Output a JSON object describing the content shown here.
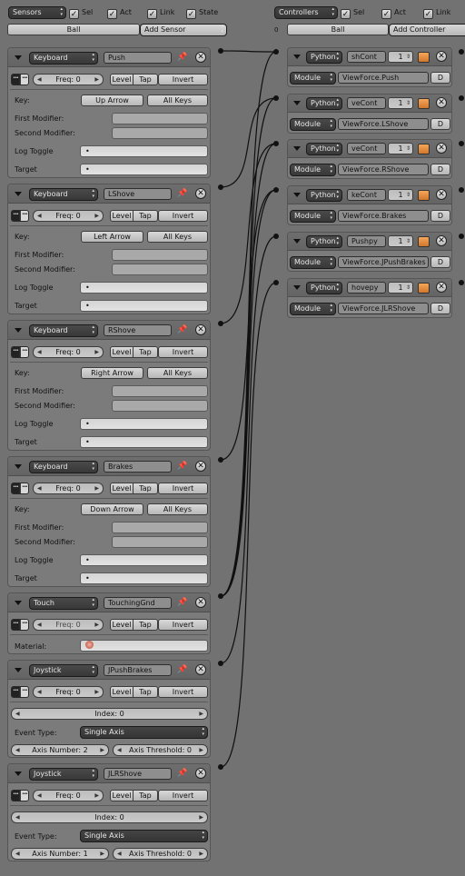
{
  "sensors_header": {
    "menu": "Sensors",
    "sel": "Sel",
    "act": "Act",
    "link": "Link",
    "state": "State",
    "object": "Ball",
    "add": "Add Sensor"
  },
  "controllers_header": {
    "menu": "Controllers",
    "sel": "Sel",
    "act": "Act",
    "link": "Link",
    "object": "Ball",
    "add": "Add Controller",
    "state_num": "0"
  },
  "freq_label": "Freq: 0",
  "level_label": "Level",
  "tap_label": "Tap",
  "invert_label": "Invert",
  "kb_labels": {
    "key": "Key:",
    "all_keys": "All Keys",
    "first": "First Modifier:",
    "second": "Second Modifier:",
    "log": "Log Toggle",
    "target": "Target",
    "dot": "•"
  },
  "keyboard_sensors": [
    {
      "type": "Keyboard",
      "name": "Push",
      "key": "Up Arrow"
    },
    {
      "type": "Keyboard",
      "name": "LShove",
      "key": "Left Arrow"
    },
    {
      "type": "Keyboard",
      "name": "RShove",
      "key": "Right Arrow"
    },
    {
      "type": "Keyboard",
      "name": "Brakes",
      "key": "Down Arrow"
    }
  ],
  "touch_sensor": {
    "type": "Touch",
    "name": "TouchingGnd",
    "material_label": "Material:"
  },
  "joystick_labels": {
    "index": "Index: 0",
    "event_type": "Event Type:",
    "event_value": "Single Axis",
    "axis_num_prefix": "Axis Number:",
    "axis_threshold": "Axis Threshold: 0"
  },
  "joystick_sensors": [
    {
      "type": "Joystick",
      "name": "JPushBrakes",
      "axis_number": "Axis Number: 2"
    },
    {
      "type": "Joystick",
      "name": "JLRShove",
      "axis_number": "Axis Number: 1"
    }
  ],
  "controllers": [
    {
      "type": "Python",
      "name": "shCont",
      "num": "1",
      "mode": "Module",
      "module": "ViewForce.Push",
      "d": "D"
    },
    {
      "type": "Python",
      "name": "veCont",
      "num": "1",
      "mode": "Module",
      "module": "ViewForce.LShove",
      "d": "D"
    },
    {
      "type": "Python",
      "name": "veCont",
      "num": "1",
      "mode": "Module",
      "module": "ViewForce.RShove",
      "d": "D"
    },
    {
      "type": "Python",
      "name": "keCont",
      "num": "1",
      "mode": "Module",
      "module": "ViewForce.Brakes",
      "d": "D"
    },
    {
      "type": "Python",
      "name": "Pushpy",
      "num": "1",
      "mode": "Module",
      "module": "ViewForce.JPushBrakes",
      "d": "D"
    },
    {
      "type": "Python",
      "name": "hovepy",
      "num": "1",
      "mode": "Module",
      "module": "ViewForce.JLRShove",
      "d": "D"
    }
  ],
  "icons": {
    "pin": "pin-icon",
    "close": "close-icon",
    "python": "script-icon",
    "material": "material-icon"
  }
}
